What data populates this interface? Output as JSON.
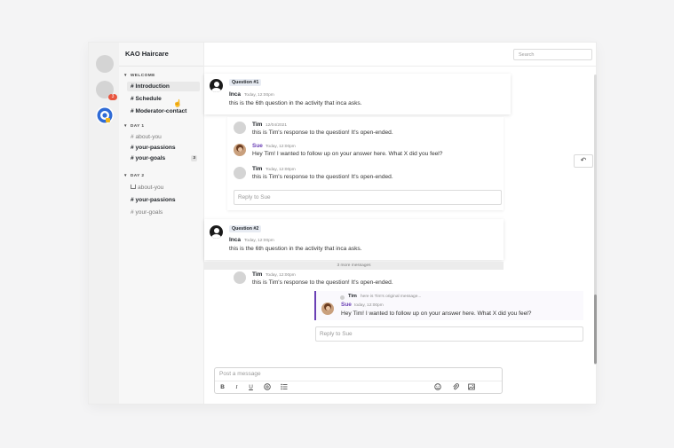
{
  "workspace": {
    "title": "KAO Haircare",
    "badge_count": "3"
  },
  "sidebar": {
    "sections": [
      {
        "label": "WELCOME",
        "channels": [
          {
            "label": "# Introduction"
          },
          {
            "label": "# Schedule"
          },
          {
            "label": "# Moderator-contact"
          }
        ]
      },
      {
        "label": "DAY 1",
        "channels": [
          {
            "label": "# about-you"
          },
          {
            "label": "# your-passions"
          },
          {
            "label": "# your-goals",
            "count": "3"
          }
        ]
      },
      {
        "label": "DAY 2",
        "channels": [
          {
            "label": "about-you"
          },
          {
            "label": "# your-passions"
          },
          {
            "label": "# your-goals"
          }
        ]
      }
    ]
  },
  "header": {
    "search_placeholder": "Search"
  },
  "questions": [
    {
      "tag": "Question #1",
      "author": "Inca",
      "time": "Today, 12:00pm",
      "text": "this is the 6th question in the activity that inca asks.",
      "replies": [
        {
          "author": "Tim",
          "time": "12/04/2021",
          "text": "this is Tim's response to the question! It's open-ended."
        },
        {
          "author": "Sue",
          "time": "Today, 12:00pm",
          "text": "Hey Tim! I wanted to follow up on your answer here. What X did you feel?"
        },
        {
          "author": "Tim",
          "time": "Today, 12:00pm",
          "text": "this is Tim's response to the question! It's open-ended."
        }
      ],
      "reply_placeholder": "Reply to Sue"
    },
    {
      "tag": "Question #2",
      "author": "Inca",
      "time": "Today, 12:00pm",
      "text": "this is the 6th question in the activity that inca asks.",
      "more_messages": "3 more messages",
      "replies": [
        {
          "author": "Tim",
          "time": "Today, 12:00pm",
          "text": "this is Tim's response to the question! It's open-ended."
        },
        {
          "author": "Sue",
          "time": "today, 12:00pm",
          "text": "Hey Tim! I wanted to follow up on your answer here. What X did you feel?",
          "quote_author": "Tim",
          "quote_text": "here is Tim's original message..."
        }
      ],
      "reply_placeholder": "Reply to Sue"
    }
  ],
  "composer": {
    "placeholder": "Post a message",
    "tools": {
      "bold": "B",
      "italic": "I",
      "underline": "U"
    }
  }
}
